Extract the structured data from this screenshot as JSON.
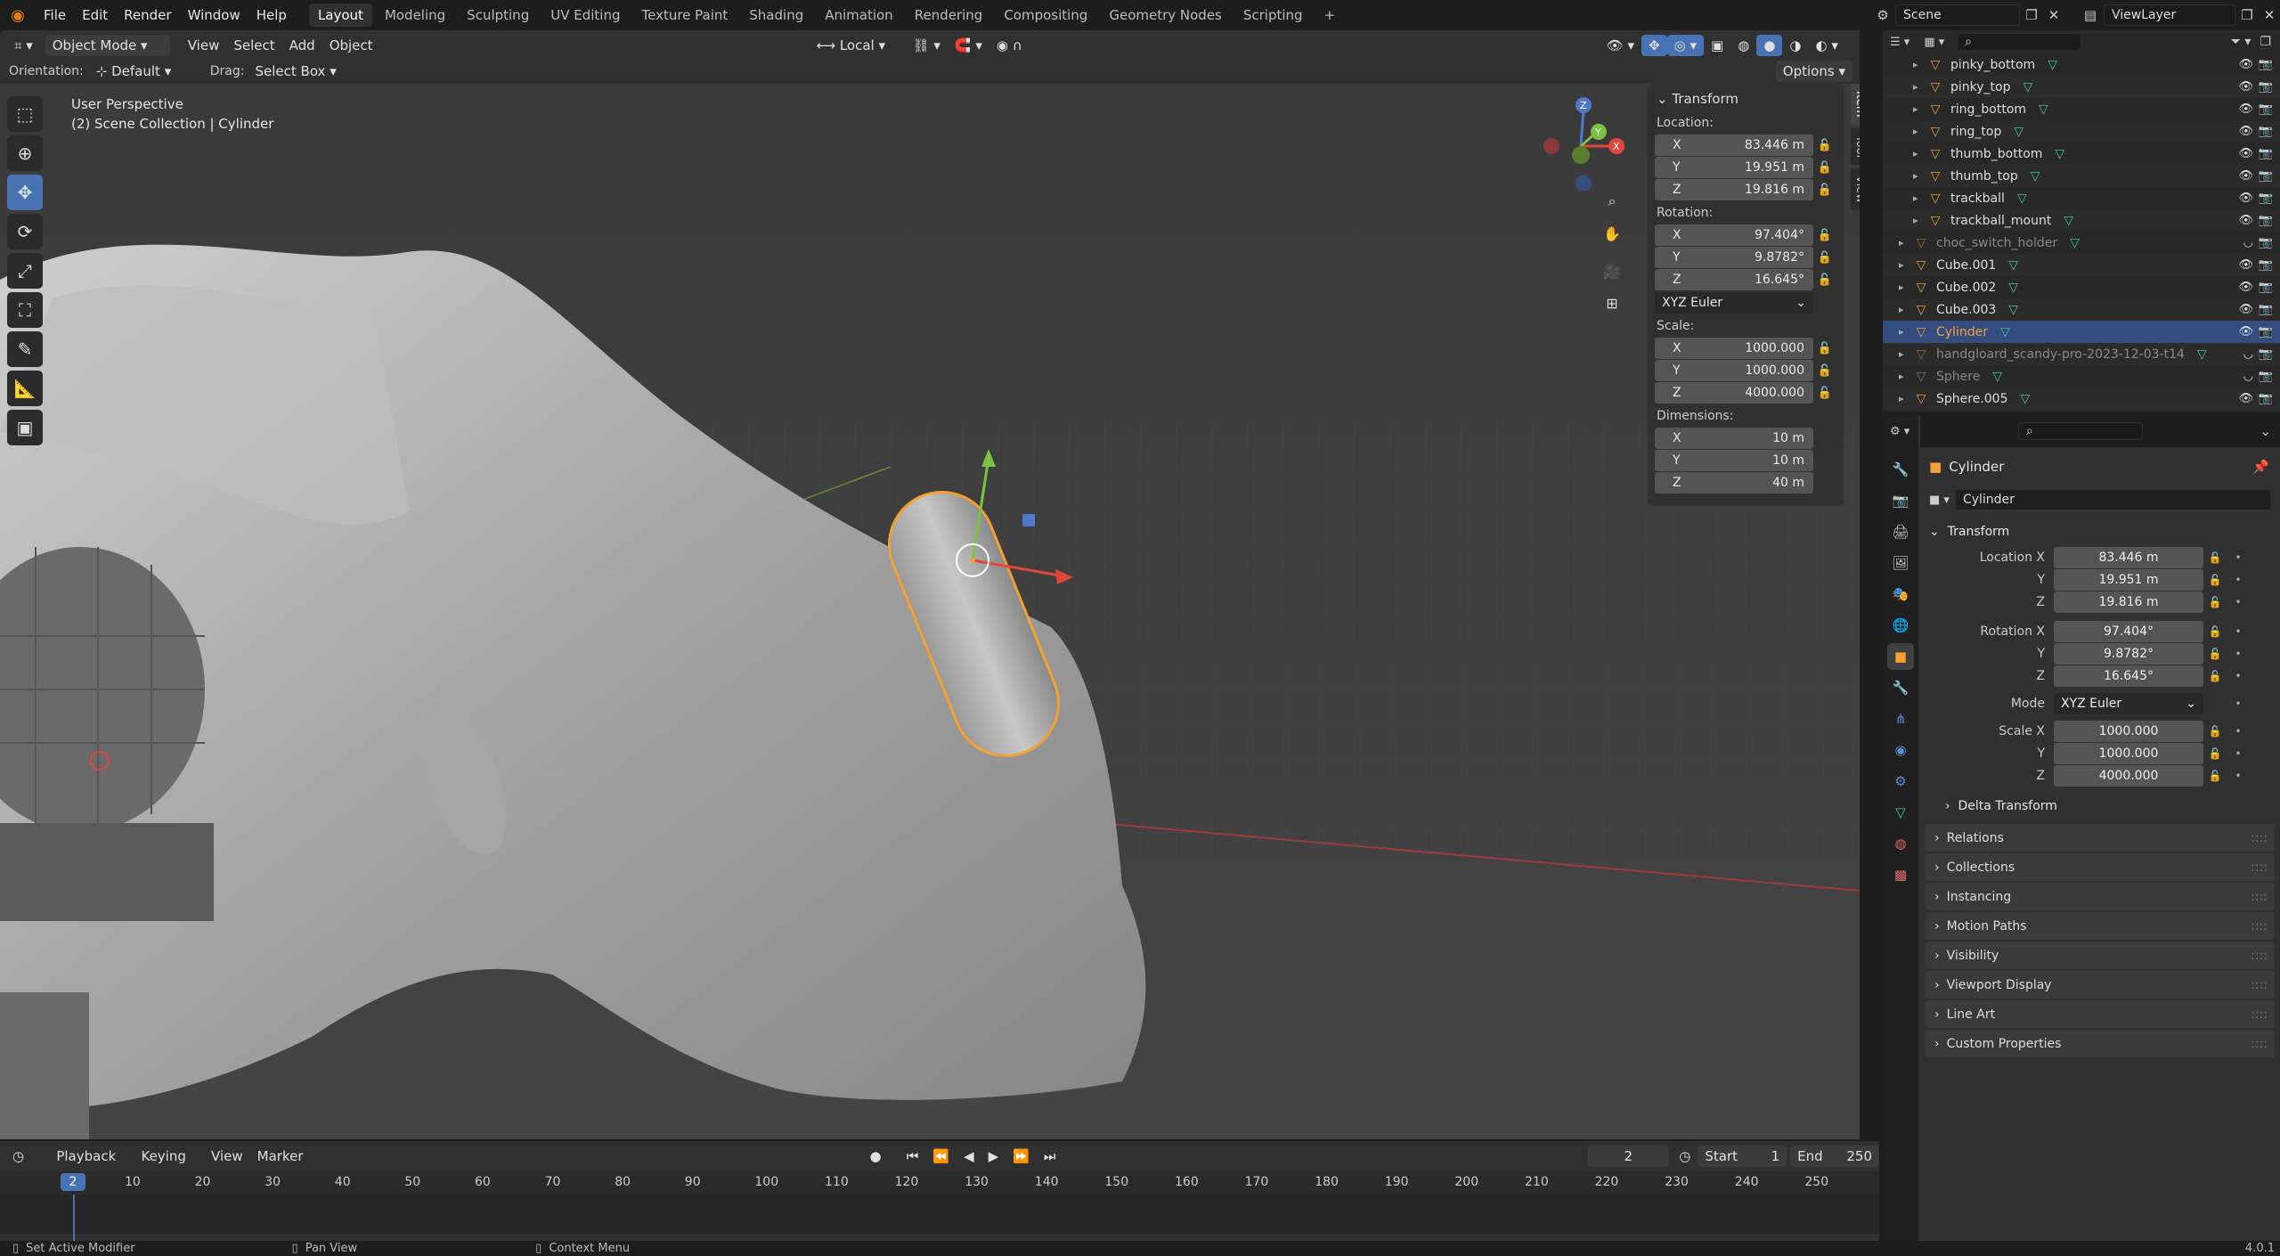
{
  "topbar": {
    "menus": [
      "File",
      "Edit",
      "Render",
      "Window",
      "Help"
    ],
    "workspaces": [
      "Layout",
      "Modeling",
      "Sculpting",
      "UV Editing",
      "Texture Paint",
      "Shading",
      "Animation",
      "Rendering",
      "Compositing",
      "Geometry Nodes",
      "Scripting"
    ],
    "active_workspace": "Layout",
    "scene": "Scene",
    "view_layer": "ViewLayer"
  },
  "viewport_header": {
    "mode": "Object Mode",
    "menus": [
      "View",
      "Select",
      "Add",
      "Object"
    ],
    "transform_orientation": "Local",
    "orientation_label": "Orientation:",
    "orientation_value": "Default",
    "drag_label": "Drag:",
    "drag_value": "Select Box",
    "options": "Options"
  },
  "viewport": {
    "view_name": "User Perspective",
    "collection_info": "(2) Scene Collection | Cylinder"
  },
  "n_panel": {
    "header": "Transform",
    "location_label": "Location:",
    "location": {
      "x": "83.446 m",
      "y": "19.951 m",
      "z": "19.816 m"
    },
    "rotation_label": "Rotation:",
    "rotation": {
      "x": "97.404°",
      "y": "9.8782°",
      "z": "16.645°"
    },
    "rotation_mode": "XYZ Euler",
    "scale_label": "Scale:",
    "scale": {
      "x": "1000.000",
      "y": "1000.000",
      "z": "4000.000"
    },
    "dimensions_label": "Dimensions:",
    "dimensions": {
      "x": "10 m",
      "y": "10 m",
      "z": "40 m"
    },
    "axis": {
      "x": "X",
      "y": "Y",
      "z": "Z"
    },
    "tabs": [
      "Item",
      "Tool",
      "View"
    ]
  },
  "timeline": {
    "menus": [
      "Playback",
      "Keying",
      "View",
      "Marker"
    ],
    "current_frame": "2",
    "start_label": "Start",
    "start": "1",
    "end_label": "End",
    "end": "250",
    "ticks": [
      "10",
      "20",
      "30",
      "40",
      "50",
      "60",
      "70",
      "80",
      "90",
      "100",
      "110",
      "120",
      "130",
      "140",
      "150",
      "160",
      "170",
      "180",
      "190",
      "200",
      "210",
      "220",
      "230",
      "240",
      "250"
    ]
  },
  "statusbar": {
    "hint1": "Set Active Modifier",
    "hint2": "Pan View",
    "hint3": "Context Menu",
    "version": "4.0.1"
  },
  "outliner": {
    "rows": [
      {
        "name": "pinky_bottom",
        "indent": 2,
        "dim": false,
        "sel": false
      },
      {
        "name": "pinky_top",
        "indent": 2,
        "dim": false,
        "sel": false
      },
      {
        "name": "ring_bottom",
        "indent": 2,
        "dim": false,
        "sel": false
      },
      {
        "name": "ring_top",
        "indent": 2,
        "dim": false,
        "sel": false
      },
      {
        "name": "thumb_bottom",
        "indent": 2,
        "dim": false,
        "sel": false
      },
      {
        "name": "thumb_top",
        "indent": 2,
        "dim": false,
        "sel": false
      },
      {
        "name": "trackball",
        "indent": 2,
        "dim": false,
        "sel": false
      },
      {
        "name": "trackball_mount",
        "indent": 2,
        "dim": false,
        "sel": false
      },
      {
        "name": "choc_switch_holder",
        "indent": 1,
        "dim": true,
        "sel": false
      },
      {
        "name": "Cube.001",
        "indent": 1,
        "dim": false,
        "sel": false
      },
      {
        "name": "Cube.002",
        "indent": 1,
        "dim": false,
        "sel": false
      },
      {
        "name": "Cube.003",
        "indent": 1,
        "dim": false,
        "sel": false
      },
      {
        "name": "Cylinder",
        "indent": 1,
        "dim": false,
        "sel": true
      },
      {
        "name": "handgloard_scandy-pro-2023-12-03-t14",
        "indent": 1,
        "dim": true,
        "sel": false
      },
      {
        "name": "Sphere",
        "indent": 1,
        "dim": true,
        "sel": false
      },
      {
        "name": "Sphere.005",
        "indent": 1,
        "dim": false,
        "sel": false
      }
    ]
  },
  "properties": {
    "object_name": "Cylinder",
    "datablock_name": "Cylinder",
    "transform_header": "Transform",
    "location_x_label": "Location X",
    "rotation_x_label": "Rotation X",
    "scale_x_label": "Scale X",
    "y_label": "Y",
    "z_label": "Z",
    "mode_label": "Mode",
    "location": {
      "x": "83.446 m",
      "y": "19.951 m",
      "z": "19.816 m"
    },
    "rotation": {
      "x": "97.404°",
      "y": "9.8782°",
      "z": "16.645°"
    },
    "mode": "XYZ Euler",
    "scale": {
      "x": "1000.000",
      "y": "1000.000",
      "z": "4000.000"
    },
    "delta_transform": "Delta Transform",
    "sections": [
      "Relations",
      "Collections",
      "Instancing",
      "Motion Paths",
      "Visibility",
      "Viewport Display",
      "Line Art",
      "Custom Properties"
    ]
  },
  "colors": {
    "accent_blue": "#4772b3",
    "selection_orange": "#f5a030",
    "mesh_icon_orange": "#e79a3c",
    "data_icon_green": "#3ec2a0"
  }
}
